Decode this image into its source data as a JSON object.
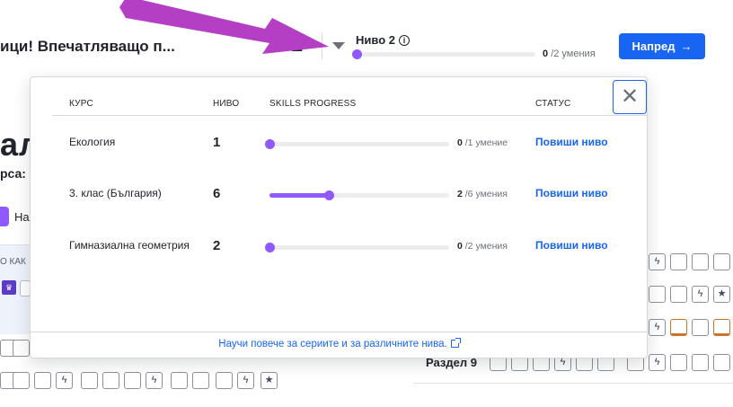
{
  "header": {
    "lesson_title": "ици! Впечатляващо п...",
    "streak_count": "2",
    "level_label": "Ниво 2",
    "level_info_icon": "info-icon",
    "level_progress": {
      "mastered": "0",
      "total_text": "/2 умения",
      "fraction": 0
    },
    "next_button": "Напред",
    "next_icon": "arrow-right-icon",
    "accent_color": "#1865f2",
    "progress_color": "#9059ff"
  },
  "background": {
    "headline": "ал",
    "subheading": "рса:",
    "pill_text": "На",
    "panel_text": "О КАК",
    "unit_label": "Раздел 9"
  },
  "popover": {
    "columns": [
      "КУРС",
      "НИВО",
      "SKILLS PROGRESS",
      "СТАТУС"
    ],
    "rows": [
      {
        "course": "Екология",
        "level": "1",
        "mastered": "0",
        "total_text": "/1 умение",
        "fraction": 0,
        "action": "Повиши ниво"
      },
      {
        "course": "3. клас (България)",
        "level": "6",
        "mastered": "2",
        "total_text": "/6 умения",
        "fraction": 0.33,
        "action": "Повиши ниво"
      },
      {
        "course": "Гимназиална геометрия",
        "level": "2",
        "mastered": "0",
        "total_text": "/2 умения",
        "fraction": 0,
        "action": "Повиши ниво"
      }
    ],
    "footer_link": "Научи повече за сериите и за различните нива.",
    "close_icon": "close-icon"
  }
}
